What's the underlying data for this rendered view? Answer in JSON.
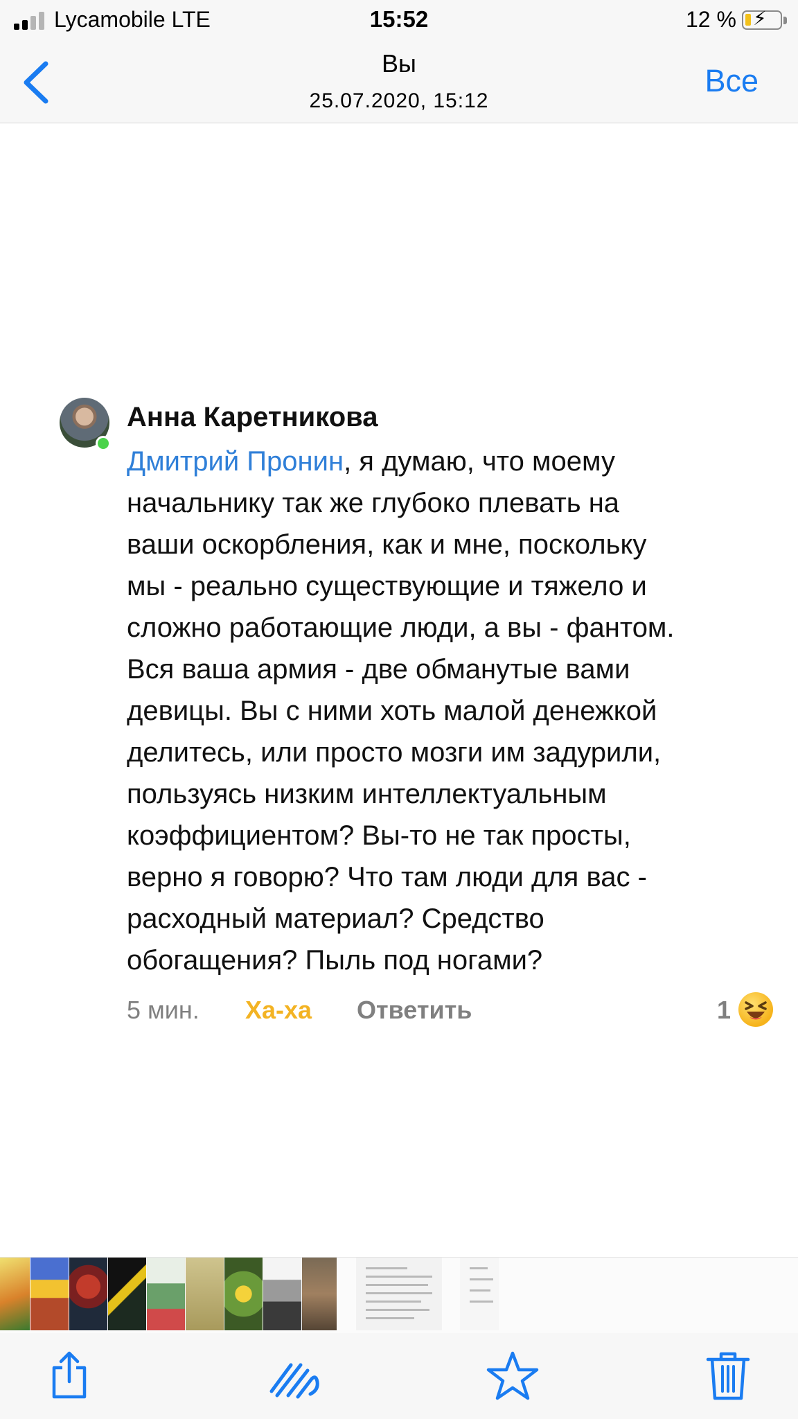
{
  "status_bar": {
    "carrier": "Lycamobile   LTE",
    "time": "15:52",
    "battery": "12 %",
    "battery_level": 0.12,
    "icons": [
      "signal-icon",
      "battery-charging-icon"
    ]
  },
  "nav": {
    "title": "Вы",
    "subtitle": "25.07.2020, 15:12",
    "all_label": "Все",
    "back_icon": "chevron-left-icon"
  },
  "comment": {
    "author": "Анна Каретникова",
    "mention": "Дмитрий Пронин",
    "lines": [
      ", я думаю, что моему",
      "начальнику так же глубоко плевать на",
      "ваши оскорбления, как и мне, поскольку",
      "мы - реально существующие и тяжело и",
      "сложно работающие люди, а вы - фантом.",
      "Вся ваша армия - две обманутые вами",
      "девицы. Вы с ними хоть малой денежкой",
      "делитесь, или просто мозги им задурили,",
      "пользуясь низким интеллектуальным",
      "коэффициентом? Вы-то не так просты,",
      "верно я говорю? Что там люди для вас -",
      "расходный материал? Средство",
      "обогащения? Пыль под ногами?"
    ],
    "time": "5 мин.",
    "reaction_label": "Ха-ха",
    "reply_label": "Ответить",
    "reaction_count": "1",
    "reaction_icon": "laughing-emoji-icon",
    "online_color": "#4bd34b",
    "mention_color": "#2f7fd8",
    "reaction_color": "#f3b323"
  },
  "thumbnails": {
    "count_photos": 9,
    "count_docs": 2
  },
  "toolbar": {
    "icons": [
      "share-icon",
      "markup-icon",
      "favorite-star-icon",
      "trash-icon"
    ],
    "accent": "#1a7cf1"
  }
}
